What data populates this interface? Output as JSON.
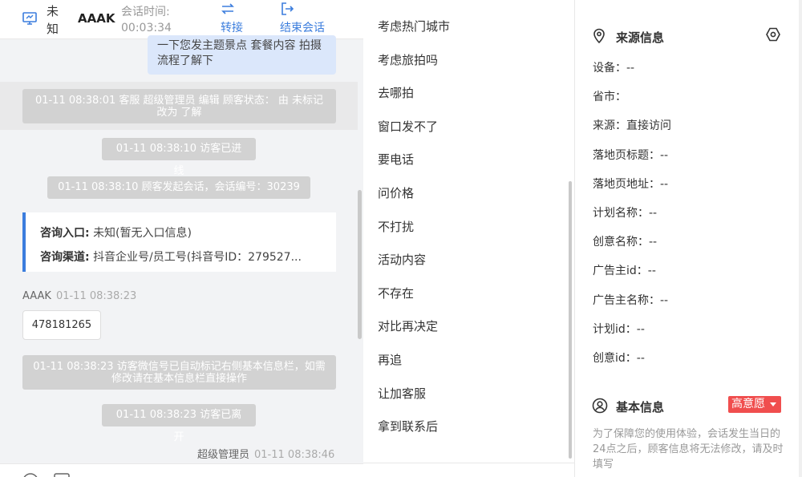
{
  "header": {
    "visitor_status": "未知",
    "visitor_name": "AAAK",
    "session_time_label": "会话时间:",
    "session_time": "00:03:34",
    "transfer_label": "转接",
    "end_label": "结束会话"
  },
  "chat": {
    "agent_bubble_text": "一下您发主题景点 套餐内容 拍摄流程了解下",
    "system_messages": [
      "01-11 08:38:01 客服 超级管理员 编辑 顾客状态： 由 未标记 改为 了解",
      "01-11 08:38:10 访客已进线",
      "01-11 08:38:10 顾客发起会话，会话编号：30239",
      "01-11 08:38:23 访客微信号已自动标记右侧基本信息栏，如需修改请在基本信息栏直接操作",
      "01-11 08:38:23 访客已离开"
    ],
    "consult_card": {
      "entry_label": "咨询入口:",
      "entry_value": "未知(暂无入口信息)",
      "channel_label": "咨询渠道:",
      "channel_value": "抖音企业号/员工号(抖音号ID：279527..."
    },
    "visitor_message": {
      "sender": "AAAK",
      "time": "01-11 08:38:23",
      "text": "478181265"
    },
    "agent_message": {
      "sender": "超级管理员",
      "time": "01-11 08:38:46"
    }
  },
  "quick_replies": [
    "考虑热门城市",
    "考虑旅拍吗",
    "去哪拍",
    "窗口发不了",
    "要电话",
    "问价格",
    "不打扰",
    "活动内容",
    "不存在",
    "对比再决定",
    "再追",
    "让加客服",
    "拿到联系后"
  ],
  "source_info": {
    "title": "来源信息",
    "fields": [
      "设备：--",
      "省市：",
      "来源：直接访问",
      "落地页标题：--",
      "落地页地址：--",
      "计划名称：--",
      "创意名称：--",
      "广告主id：--",
      "广告主名称：--",
      "计划id：--",
      "创意id：--"
    ]
  },
  "basic_info": {
    "title": "基本信息",
    "intent_badge": "高意愿",
    "note": "为了保障您的使用体验，会话发生当日的24点之后，顾客信息将无法修改，请及时填写"
  },
  "colors": {
    "accent": "#3b7ddd",
    "badge": "#f04e4e",
    "system_bubble": "#d2d2d2",
    "agent_bubble": "#dbe7fb"
  }
}
